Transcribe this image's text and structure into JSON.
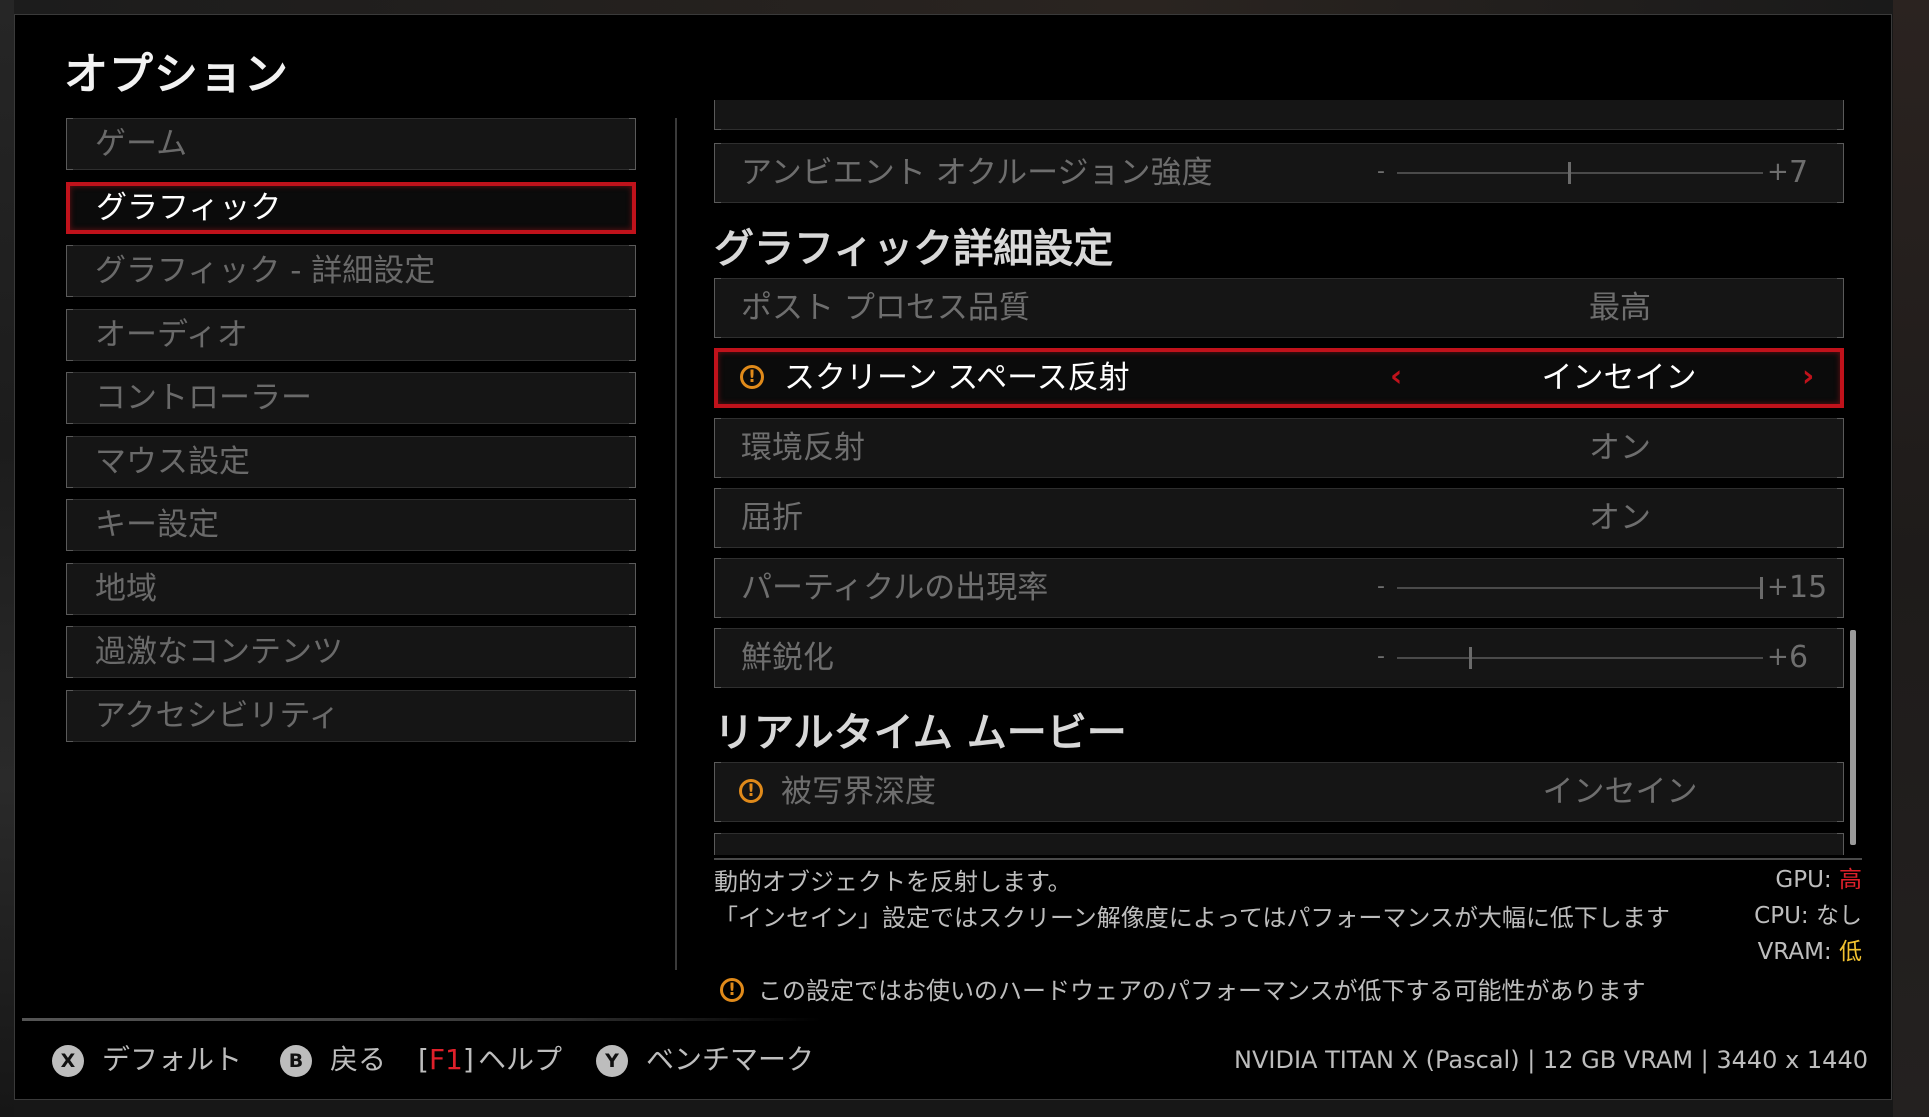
{
  "page_title": "オプション",
  "nav": [
    {
      "label": "ゲーム",
      "active": false
    },
    {
      "label": "グラフィック",
      "active": true
    },
    {
      "label": "グラフィック - 詳細設定",
      "active": false
    },
    {
      "label": "オーディオ",
      "active": false
    },
    {
      "label": "コントローラー",
      "active": false
    },
    {
      "label": "マウス設定",
      "active": false
    },
    {
      "label": "キー設定",
      "active": false
    },
    {
      "label": "地域",
      "active": false
    },
    {
      "label": "過激なコンテンツ",
      "active": false
    },
    {
      "label": "アクセシビリティ",
      "active": false
    }
  ],
  "settings": {
    "ambient_occlusion": {
      "label": "アンビエント オクルージョン強度",
      "value": "7",
      "level": 0.47
    },
    "section_advanced": "グラフィック詳細設定",
    "post_process": {
      "label": "ポスト プロセス品質",
      "value": "最高"
    },
    "ssr": {
      "label": "スクリーン スペース反射",
      "value": "インセイン",
      "prev": "‹",
      "next": "›"
    },
    "env_reflection": {
      "label": "環境反射",
      "value": "オン"
    },
    "refraction": {
      "label": "屈折",
      "value": "オン"
    },
    "particle": {
      "label": "パーティクルの出現率",
      "value": "15",
      "level": 1.0
    },
    "sharpen": {
      "label": "鮮鋭化",
      "value": "6",
      "level": 0.2
    },
    "section_cinematic": "リアルタイム ムービー",
    "dof": {
      "label": "被写界深度",
      "value": "インセイン"
    }
  },
  "description": {
    "line1": "動的オブジェクトを反射します。",
    "line2": "「インセイン」設定ではスクリーン解像度によってはパフォーマンスが大幅に低下します",
    "warning": "この設定ではお使いのハードウェアのパフォーマンスが低下する可能性があります"
  },
  "impact": {
    "gpu_label": "GPU:",
    "gpu_value": "高",
    "cpu_label": "CPU:",
    "cpu_value": "なし",
    "vram_label": "VRAM:",
    "vram_value": "低"
  },
  "footer": {
    "x_key": "X",
    "x_label": "デフォルト",
    "b_key": "B",
    "b_label": "戻る",
    "f1_open": "[",
    "f1_key": "F1",
    "f1_close": "]",
    "f1_label": "ヘルプ",
    "y_key": "Y",
    "y_label": "ベンチマーク",
    "hardware": "NVIDIA TITAN X (Pascal) | 12 GB VRAM | 3440 x 1440"
  },
  "colors": {
    "accent_red": "#c0121b",
    "warning_orange": "#e08a1a",
    "impact_high": "#e0202a",
    "impact_low": "#f2c230"
  }
}
